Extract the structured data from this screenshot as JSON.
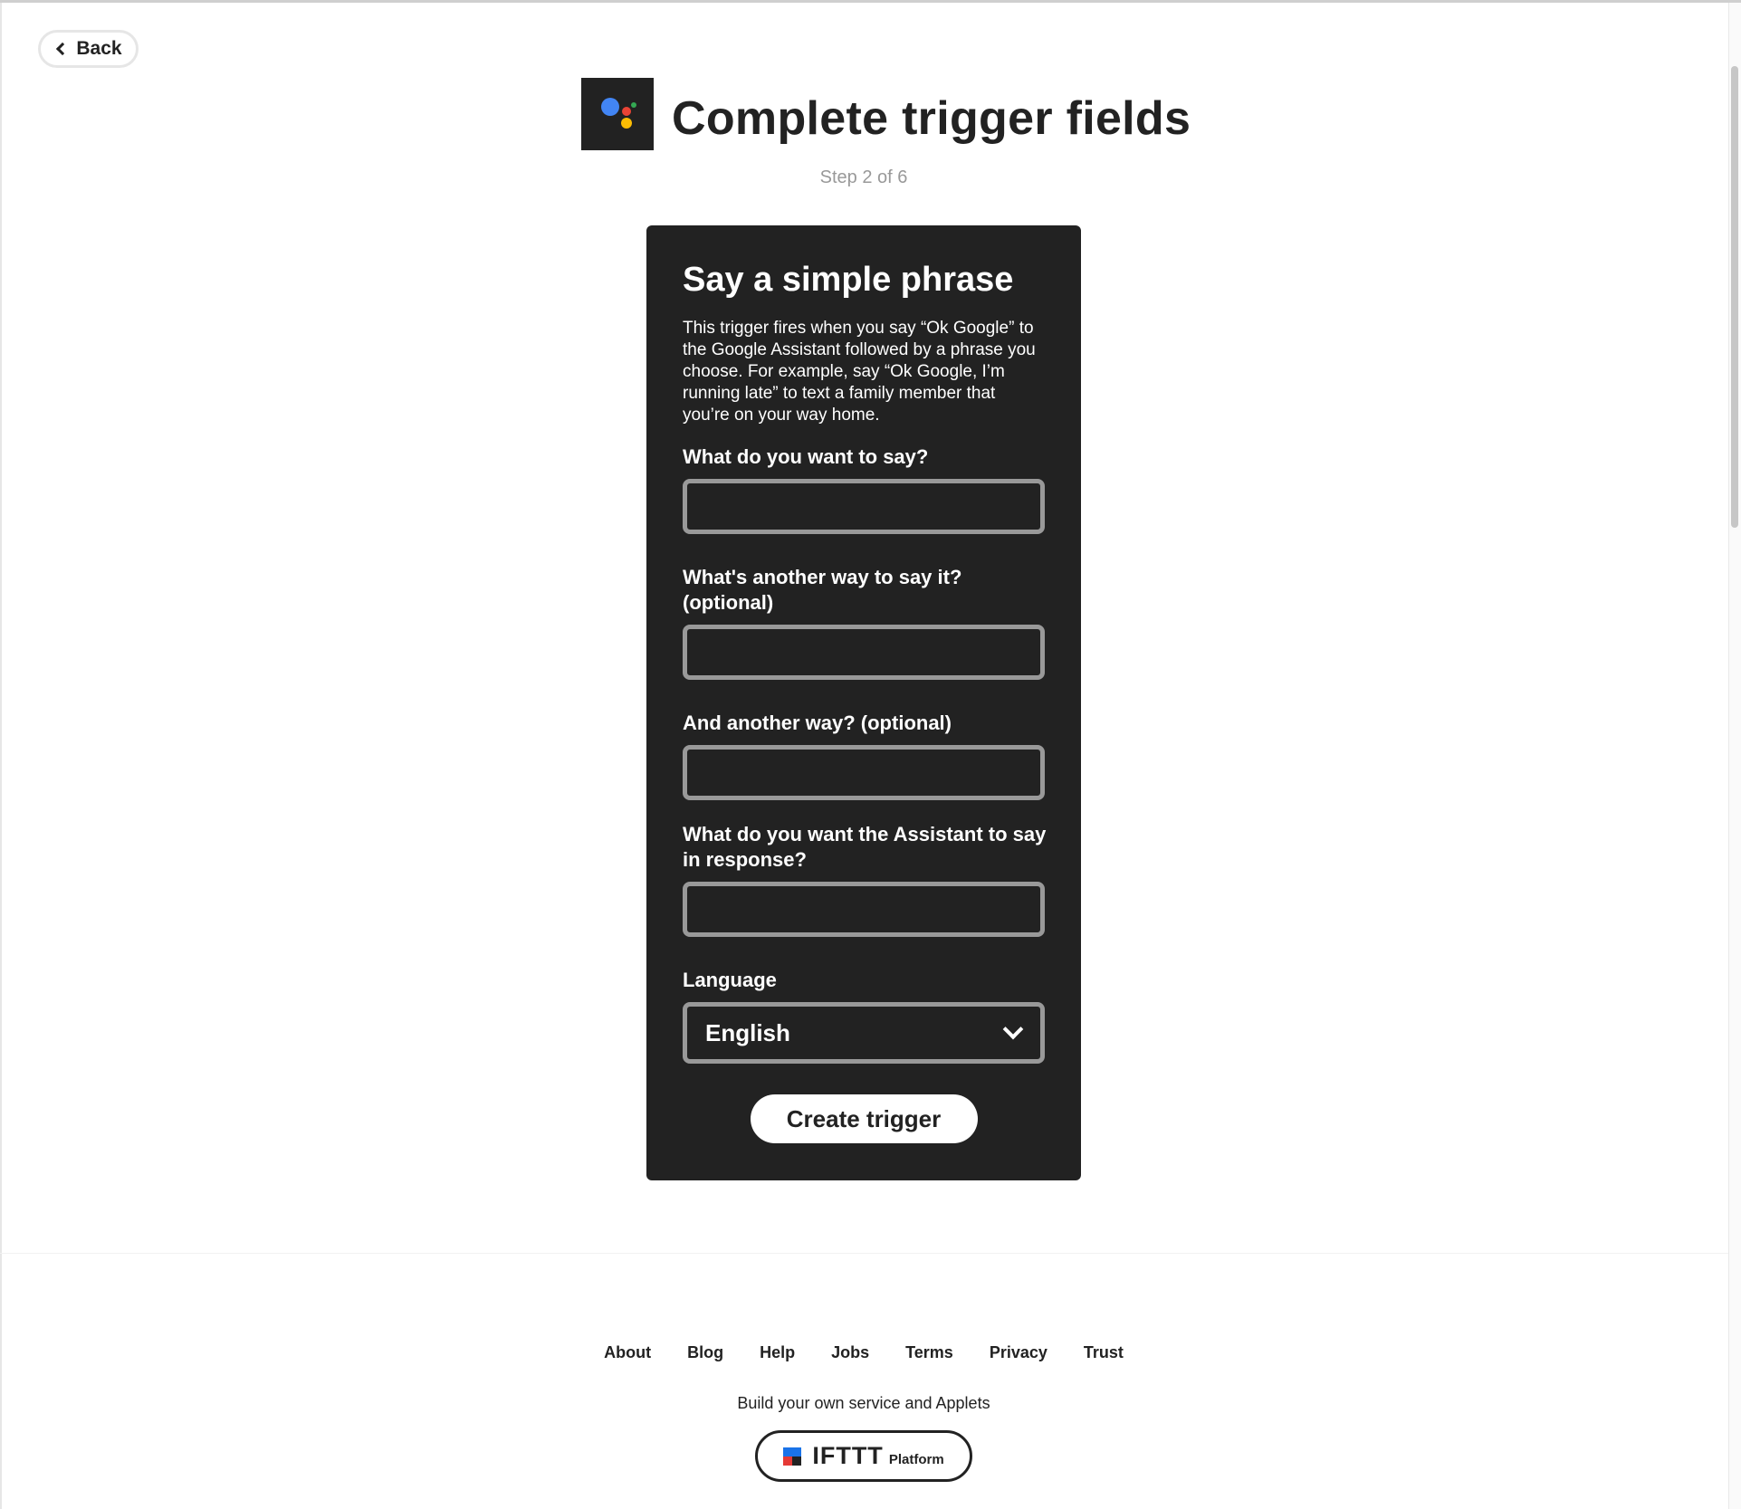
{
  "header": {
    "back_label": "Back",
    "title": "Complete trigger fields",
    "step": "Step 2 of 6",
    "service_icon": "google-assistant-icon"
  },
  "card": {
    "title": "Say a simple phrase",
    "description": "This trigger fires when you say “Ok Google” to the Google Assistant followed by a phrase you choose. For example, say “Ok Google, I’m running late” to text a family member that you’re on your way home.",
    "fields": [
      {
        "label": "What do you want to say?",
        "value": ""
      },
      {
        "label": "What's another way to say it? (optional)",
        "value": ""
      },
      {
        "label": "And another way? (optional)",
        "value": ""
      },
      {
        "label": "What do you want the Assistant to say in response?",
        "value": ""
      }
    ],
    "language": {
      "label": "Language",
      "selected": "English"
    },
    "submit_label": "Create trigger"
  },
  "footer": {
    "links": [
      "About",
      "Blog",
      "Help",
      "Jobs",
      "Terms",
      "Privacy",
      "Trust"
    ],
    "build_text": "Build your own service and Applets",
    "platform_logo_text": "IFTTT",
    "platform_label": "Platform"
  },
  "colors": {
    "card_bg": "#222222",
    "field_border": "#999999",
    "text_dark": "#222222",
    "muted": "#999999",
    "assistant_blue": "#4285f4",
    "assistant_red": "#ea4335",
    "assistant_yellow": "#fbbc04",
    "assistant_green": "#34a853"
  }
}
